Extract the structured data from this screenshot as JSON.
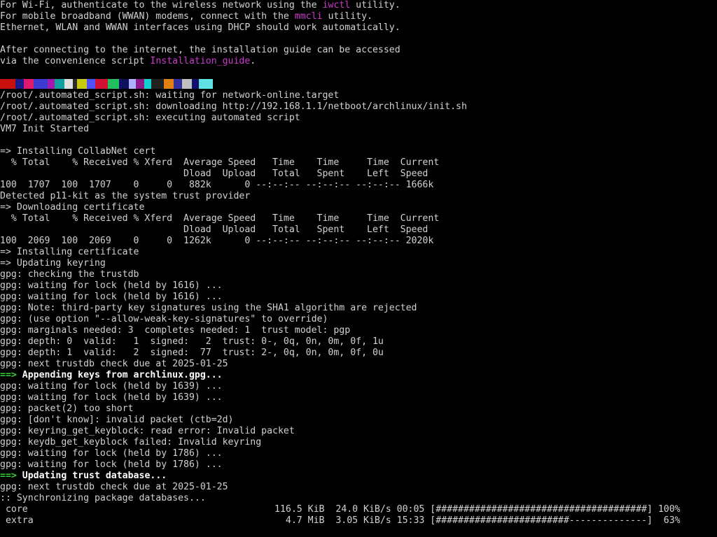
{
  "colors": {
    "background": "#000000",
    "text": "#d2d2d2",
    "highlight_magenta": "#cc3acc",
    "arrow_green": "#3ad23a",
    "bold_white": "#ffffff"
  },
  "intro": {
    "wifi_pre": "For Wi-Fi, authenticate to the wireless network using the ",
    "wifi_tool": "iwctl",
    "wifi_post": " utility.",
    "wwan_pre": "For mobile broadband (WWAN) modems, connect with the ",
    "wwan_tool": "mmcli",
    "wwan_post": " utility.",
    "dhcp": "Ethernet, WLAN and WWAN interfaces using DHCP should work automatically.",
    "guide_1": "After connecting to the internet, the installation guide can be accessed",
    "guide_2_pre": "via the convenience script ",
    "guide_2_link": "Installation_guide",
    "guide_2_post": "."
  },
  "glitch_colors": [
    "#c81010",
    "#1a1a8a",
    "#e01a6a",
    "#3a3ad0",
    "#a01ab0",
    "#10a0a0",
    "#e0e0e0",
    "#2a2a2a",
    "#c8c810",
    "#5050ff",
    "#d01030",
    "#20c060",
    "#101060",
    "#b0b0ff",
    "#8a1a8a",
    "#10d0d0",
    "#202020",
    "#e08010",
    "#3030a0",
    "#c0c0c0",
    "#10106a",
    "#60e0e0"
  ],
  "log": [
    "/root/.automated_script.sh: waiting for network-online.target",
    "/root/.automated_script.sh: downloading http://192.168.1.1/netboot/archlinux/init.sh",
    "/root/.automated_script.sh: executing automated script",
    "VM7 Init Started",
    "",
    "=> Installing CollabNet cert",
    "  % Total    % Received % Xferd  Average Speed   Time    Time     Time  Current",
    "                                 Dload  Upload   Total   Spent    Left  Speed",
    "100  1707  100  1707    0     0   882k      0 --:--:-- --:--:-- --:--:-- 1666k",
    "Detected p11-kit as the system trust provider",
    "=> Downloading certificate",
    "  % Total    % Received % Xferd  Average Speed   Time    Time     Time  Current",
    "                                 Dload  Upload   Total   Spent    Left  Speed",
    "100  2069  100  2069    0     0  1262k      0 --:--:-- --:--:-- --:--:-- 2020k",
    "=> Installing certificate",
    "=> Updating keyring",
    "gpg: checking the trustdb",
    "gpg: waiting for lock (held by 1616) ...",
    "gpg: waiting for lock (held by 1616) ...",
    "gpg: Note: third-party key signatures using the SHA1 algorithm are rejected",
    "gpg: (use option \"--allow-weak-key-signatures\" to override)",
    "gpg: marginals needed: 3  completes needed: 1  trust model: pgp",
    "gpg: depth: 0  valid:   1  signed:   2  trust: 0-, 0q, 0n, 0m, 0f, 1u",
    "gpg: depth: 1  valid:   2  signed:  77  trust: 2-, 0q, 0n, 0m, 0f, 0u",
    "gpg: next trustdb check due at 2025-01-25"
  ],
  "append": {
    "arrow": "==>",
    "text": " Appending keys from archlinux.gpg..."
  },
  "log2": [
    "gpg: waiting for lock (held by 1639) ...",
    "gpg: waiting for lock (held by 1639) ...",
    "gpg: packet(2) too short",
    "gpg: [don't know]: invalid packet (ctb=2d)",
    "gpg: keyring_get_keyblock: read error: Invalid packet",
    "gpg: keydb_get_keyblock failed: Invalid keyring",
    "gpg: waiting for lock (held by 1786) ...",
    "gpg: waiting for lock (held by 1786) ..."
  ],
  "update": {
    "arrow": "==>",
    "text": " Updating trust database..."
  },
  "log3": [
    "gpg: next trustdb check due at 2025-01-25",
    ":: Synchronizing package databases..."
  ],
  "packages": [
    {
      "name": " core",
      "stats": "116.5 KiB  24.0 KiB/s 00:05 [######################################] 100%"
    },
    {
      "name": " extra",
      "stats": "  4.7 MiB  3.05 KiB/s 15:33 [########################--------------]  63%"
    }
  ]
}
